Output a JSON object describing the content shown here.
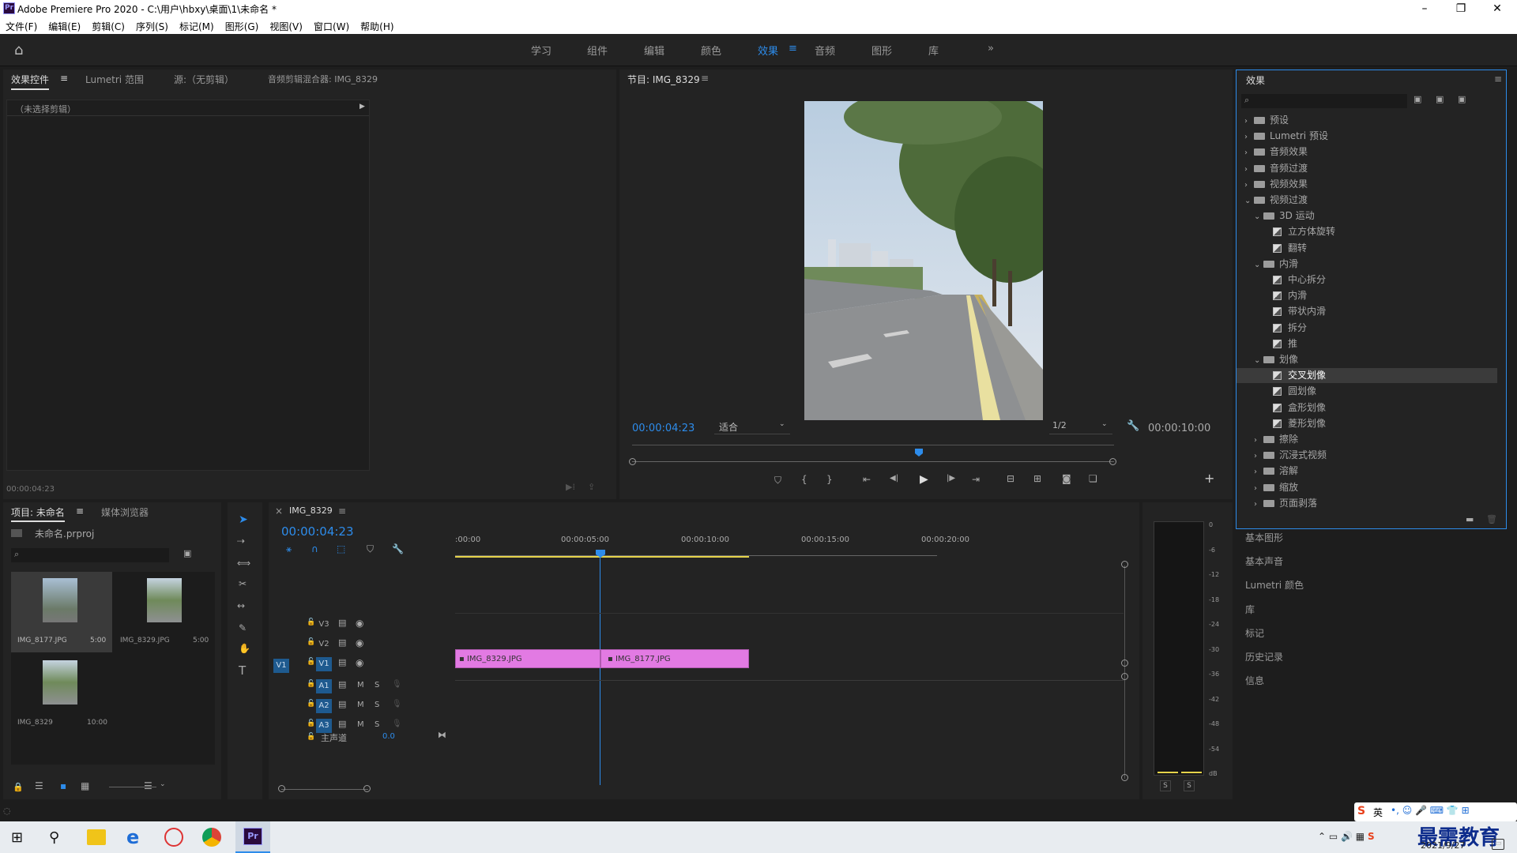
{
  "window": {
    "title": "Adobe Premiere Pro 2020 - C:\\用户\\hbxy\\桌面\\1\\未命名 *",
    "logo": "Pr"
  },
  "menu": [
    "文件(F)",
    "编辑(E)",
    "剪辑(C)",
    "序列(S)",
    "标记(M)",
    "图形(G)",
    "视图(V)",
    "窗口(W)",
    "帮助(H)"
  ],
  "workspaces": [
    "学习",
    "组件",
    "编辑",
    "颜色",
    "效果",
    "音频",
    "图形",
    "库"
  ],
  "active_workspace": "效果",
  "source_panel": {
    "tabs": [
      "效果控件",
      "Lumetri 范围",
      "源:（无剪辑）",
      "音频剪辑混合器: IMG_8329"
    ],
    "no_clip": "（未选择剪辑）",
    "timecode": "00:00:04:23"
  },
  "program": {
    "title": "节目: IMG_8329",
    "timecode": "00:00:04:23",
    "fit": "适合",
    "res": "1/2",
    "duration": "00:00:10:00"
  },
  "effects": {
    "title": "效果",
    "tree": [
      {
        "label": "预设",
        "level": 0,
        "kind": "folder-special",
        "arrow": "›"
      },
      {
        "label": "Lumetri 预设",
        "level": 0,
        "kind": "folder-special",
        "arrow": "›"
      },
      {
        "label": "音频效果",
        "level": 0,
        "kind": "folder",
        "arrow": "›"
      },
      {
        "label": "音频过渡",
        "level": 0,
        "kind": "folder",
        "arrow": "›"
      },
      {
        "label": "视频效果",
        "level": 0,
        "kind": "folder",
        "arrow": "›"
      },
      {
        "label": "视频过渡",
        "level": 0,
        "kind": "folder",
        "arrow": "⌄"
      },
      {
        "label": "3D 运动",
        "level": 1,
        "kind": "folder",
        "arrow": "⌄"
      },
      {
        "label": "立方体旋转",
        "level": 2,
        "kind": "fx",
        "arrow": ""
      },
      {
        "label": "翻转",
        "level": 2,
        "kind": "fx",
        "arrow": ""
      },
      {
        "label": "内滑",
        "level": 1,
        "kind": "folder",
        "arrow": "⌄"
      },
      {
        "label": "中心拆分",
        "level": 2,
        "kind": "fx",
        "arrow": ""
      },
      {
        "label": "内滑",
        "level": 2,
        "kind": "fx",
        "arrow": ""
      },
      {
        "label": "带状内滑",
        "level": 2,
        "kind": "fx",
        "arrow": ""
      },
      {
        "label": "拆分",
        "level": 2,
        "kind": "fx",
        "arrow": ""
      },
      {
        "label": "推",
        "level": 2,
        "kind": "fx",
        "arrow": ""
      },
      {
        "label": "划像",
        "level": 1,
        "kind": "folder",
        "arrow": "⌄"
      },
      {
        "label": "交叉划像",
        "level": 2,
        "kind": "fx",
        "arrow": "",
        "selected": true
      },
      {
        "label": "圆划像",
        "level": 2,
        "kind": "fx",
        "arrow": ""
      },
      {
        "label": "盒形划像",
        "level": 2,
        "kind": "fx",
        "arrow": ""
      },
      {
        "label": "菱形划像",
        "level": 2,
        "kind": "fx",
        "arrow": ""
      },
      {
        "label": "擦除",
        "level": 1,
        "kind": "folder",
        "arrow": "›"
      },
      {
        "label": "沉浸式视频",
        "level": 1,
        "kind": "folder",
        "arrow": "›"
      },
      {
        "label": "溶解",
        "level": 1,
        "kind": "folder",
        "arrow": "›"
      },
      {
        "label": "缩放",
        "level": 1,
        "kind": "folder",
        "arrow": "›"
      },
      {
        "label": "页面剥落",
        "level": 1,
        "kind": "folder",
        "arrow": "›"
      }
    ],
    "side_panels": [
      "基本图形",
      "基本声音",
      "Lumetri 颜色",
      "库",
      "标记",
      "历史记录",
      "信息"
    ]
  },
  "project": {
    "tabs": [
      "项目: 未命名",
      "媒体浏览器"
    ],
    "file": "未命名.prproj",
    "items": [
      {
        "name": "IMG_8177.JPG",
        "dur": "5:00"
      },
      {
        "name": "IMG_8329.JPG",
        "dur": "5:00"
      },
      {
        "name": "IMG_8329",
        "dur": "10:00"
      }
    ]
  },
  "timeline": {
    "tab": "IMG_8329",
    "timecode": "00:00:04:23",
    "ruler": [
      ":00:00",
      "00:00:05:00",
      "00:00:10:00",
      "00:00:15:00",
      "00:00:20:00"
    ],
    "video_tracks": [
      "V3",
      "V2",
      "V1"
    ],
    "audio_tracks": [
      "A1",
      "A2",
      "A3"
    ],
    "master_label": "主声道",
    "master_val": "0.0",
    "src_patch": "V1",
    "clips": [
      {
        "name": "IMG_8329.JPG"
      },
      {
        "name": "IMG_8177.JPG"
      }
    ],
    "m": "M",
    "s": "S"
  },
  "meter": {
    "scale": [
      "0",
      "-6",
      "-12",
      "-18",
      "-24",
      "-30",
      "-36",
      "-42",
      "-48",
      "-54",
      "dB"
    ],
    "solo": [
      "S",
      "S"
    ]
  },
  "taskbar": {
    "date": "2021/9/27",
    "ime": "英",
    "watermark": "最需教育"
  },
  "colors": {
    "accent": "#2d8ceb",
    "clip": "#e27ae3",
    "bg": "#1d1d1d"
  }
}
